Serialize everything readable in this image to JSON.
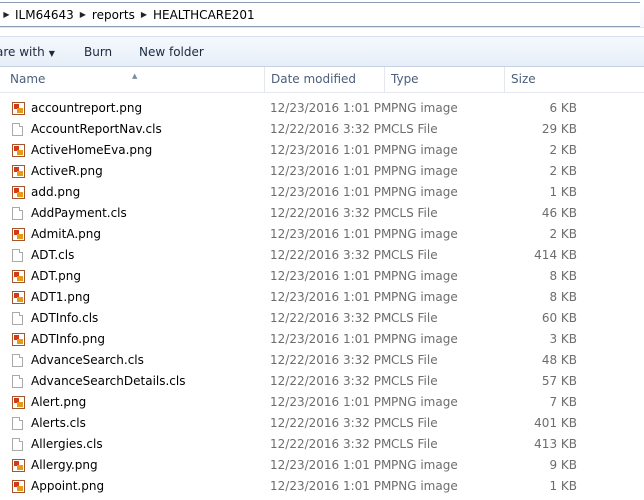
{
  "breadcrumb": [
    "ILM64643",
    "reports",
    "HEALTHCARE201"
  ],
  "toolbar": {
    "share_with": "are with",
    "burn": "Burn",
    "new_folder": "New folder"
  },
  "columns": {
    "name": "Name",
    "date_modified": "Date modified",
    "type": "Type",
    "size": "Size"
  },
  "files": [
    {
      "name": "accountreport.png",
      "date": "12/23/2016 1:01 PM",
      "type": "PNG image",
      "size": "6 KB",
      "icon": "png-file-icon"
    },
    {
      "name": "AccountReportNav.cls",
      "date": "12/22/2016 3:32 PM",
      "type": "CLS File",
      "size": "29 KB",
      "icon": "cls-file-icon"
    },
    {
      "name": "ActiveHomeEva.png",
      "date": "12/23/2016 1:01 PM",
      "type": "PNG image",
      "size": "2 KB",
      "icon": "png-file-icon"
    },
    {
      "name": "ActiveR.png",
      "date": "12/23/2016 1:01 PM",
      "type": "PNG image",
      "size": "2 KB",
      "icon": "png-file-icon"
    },
    {
      "name": "add.png",
      "date": "12/23/2016 1:01 PM",
      "type": "PNG image",
      "size": "1 KB",
      "icon": "png-file-icon"
    },
    {
      "name": "AddPayment.cls",
      "date": "12/22/2016 3:32 PM",
      "type": "CLS File",
      "size": "46 KB",
      "icon": "cls-file-icon"
    },
    {
      "name": "AdmitA.png",
      "date": "12/23/2016 1:01 PM",
      "type": "PNG image",
      "size": "2 KB",
      "icon": "png-file-icon"
    },
    {
      "name": "ADT.cls",
      "date": "12/22/2016 3:32 PM",
      "type": "CLS File",
      "size": "414 KB",
      "icon": "cls-file-icon"
    },
    {
      "name": "ADT.png",
      "date": "12/23/2016 1:01 PM",
      "type": "PNG image",
      "size": "8 KB",
      "icon": "png-file-icon"
    },
    {
      "name": "ADT1.png",
      "date": "12/23/2016 1:01 PM",
      "type": "PNG image",
      "size": "8 KB",
      "icon": "png-file-icon"
    },
    {
      "name": "ADTInfo.cls",
      "date": "12/22/2016 3:32 PM",
      "type": "CLS File",
      "size": "60 KB",
      "icon": "cls-file-icon"
    },
    {
      "name": "ADTInfo.png",
      "date": "12/23/2016 1:01 PM",
      "type": "PNG image",
      "size": "3 KB",
      "icon": "png-file-icon"
    },
    {
      "name": "AdvanceSearch.cls",
      "date": "12/22/2016 3:32 PM",
      "type": "CLS File",
      "size": "48 KB",
      "icon": "cls-file-icon"
    },
    {
      "name": "AdvanceSearchDetails.cls",
      "date": "12/22/2016 3:32 PM",
      "type": "CLS File",
      "size": "57 KB",
      "icon": "cls-file-icon"
    },
    {
      "name": "Alert.png",
      "date": "12/23/2016 1:01 PM",
      "type": "PNG image",
      "size": "7 KB",
      "icon": "png-file-icon"
    },
    {
      "name": "Alerts.cls",
      "date": "12/22/2016 3:32 PM",
      "type": "CLS File",
      "size": "401 KB",
      "icon": "cls-file-icon"
    },
    {
      "name": "Allergies.cls",
      "date": "12/22/2016 3:32 PM",
      "type": "CLS File",
      "size": "413 KB",
      "icon": "cls-file-icon"
    },
    {
      "name": "Allergy.png",
      "date": "12/23/2016 1:01 PM",
      "type": "PNG image",
      "size": "9 KB",
      "icon": "png-file-icon"
    },
    {
      "name": "Appoint.png",
      "date": "12/23/2016 1:01 PM",
      "type": "PNG image",
      "size": "1 KB",
      "icon": "png-file-icon"
    }
  ]
}
